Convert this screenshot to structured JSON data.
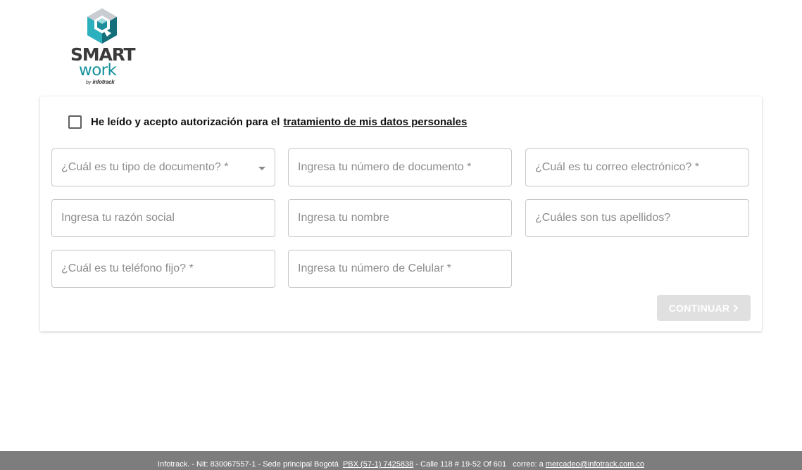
{
  "brand": {
    "logo_word_1": "SMART",
    "logo_word_2": "work",
    "logo_by": "by",
    "logo_company": "infotrack",
    "colors": {
      "teal_dark": "#1a7f8c",
      "teal_light": "#28b5c2",
      "grey": "#3a3a3a"
    }
  },
  "form": {
    "consent_text": "He leído y acepto autorización para el",
    "consent_link": "tratamiento de mis datos personales",
    "fields": {
      "document_type": "¿Cuál es tu tipo de documento? *",
      "document_number": "Ingresa tu número de documento *",
      "email": "¿Cuál es tu correo electrónico? *",
      "business_name": "Ingresa tu razón social",
      "first_name": "Ingresa tu nombre",
      "last_names": "¿Cuáles son tus apellidos?",
      "landline": "¿Cuál es tu teléfono fijo? *",
      "mobile": "Ingresa tu número de Celular *"
    },
    "continue_label": "CONTINUAR",
    "continue_icon": "chevron-right-icon"
  },
  "footer": {
    "text_1": "Infotrack. - Nit: 830067557-1 - Sede principal Bogotá  ",
    "pbx": "PBX (57-1) 7425838",
    "text_2": " - Calle 118 # 19-52 Of 601   correo: a ",
    "email": "mercadeo@infotrack.com.co",
    "background": "#7d7d7d"
  }
}
